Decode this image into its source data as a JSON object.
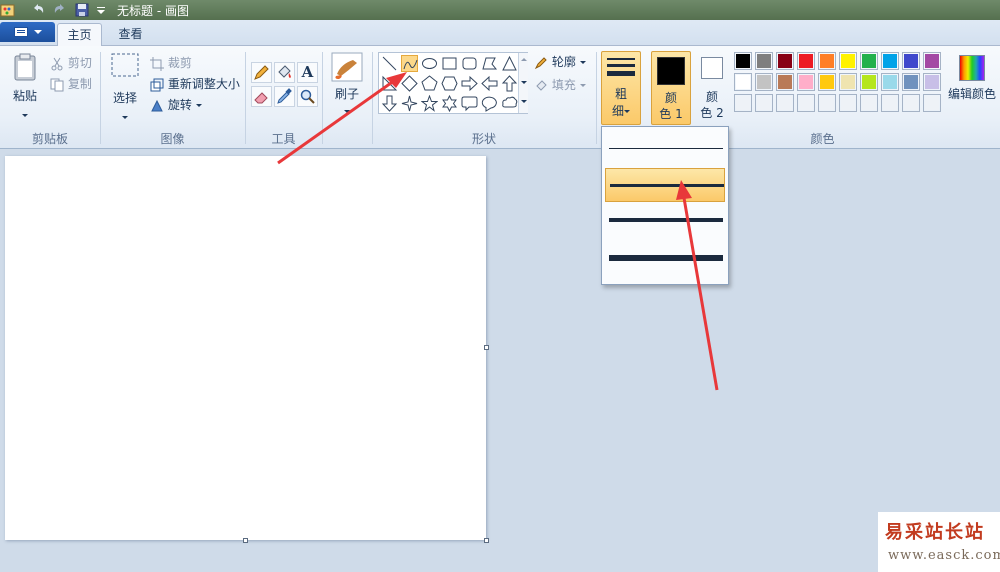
{
  "titlebar": {
    "title": "无标题 - 画图"
  },
  "tabs": {
    "home": "主页",
    "view": "查看"
  },
  "clipboard": {
    "paste": "粘贴",
    "cut": "剪切",
    "copy": "复制",
    "label": "剪贴板"
  },
  "image": {
    "select": "选择",
    "crop": "裁剪",
    "resize": "重新调整大小",
    "rotate": "旋转",
    "label": "图像"
  },
  "tools": {
    "label": "工具",
    "text_glyph": "A"
  },
  "brushes": {
    "label": "刷子"
  },
  "shapes": {
    "outline": "轮廓",
    "fill": "填充",
    "label": "形状",
    "selected": "curve"
  },
  "size": {
    "label_line1": "粗",
    "label_line2": "细"
  },
  "colors": {
    "color1_line1": "颜",
    "color1_line2": "色 1",
    "color2_line1": "颜",
    "color2_line2": "色 2",
    "label": "颜色",
    "edit": "编辑颜色",
    "color1_value": "#000000",
    "color2_value": "#ffffff",
    "palette_row1": [
      "#000000",
      "#7f7f7f",
      "#880015",
      "#ed1c24",
      "#ff7f27",
      "#fff200",
      "#22b14c",
      "#00a2e8",
      "#3f48cc",
      "#a349a4"
    ],
    "palette_row2": [
      "#ffffff",
      "#c3c3c3",
      "#b97a57",
      "#ffaec9",
      "#ffc90e",
      "#efe4b0",
      "#b5e61d",
      "#99d9ea",
      "#7092be",
      "#c8bfe7"
    ]
  },
  "dropdown": {
    "options": [
      "1px",
      "3px",
      "5px",
      "8px"
    ],
    "selected_index": 1
  },
  "watermark": {
    "logo": "易采站长站",
    "url": "www.easck.com"
  },
  "accent": {
    "arrow": "#e8383a",
    "highlight": "#fbc969"
  }
}
